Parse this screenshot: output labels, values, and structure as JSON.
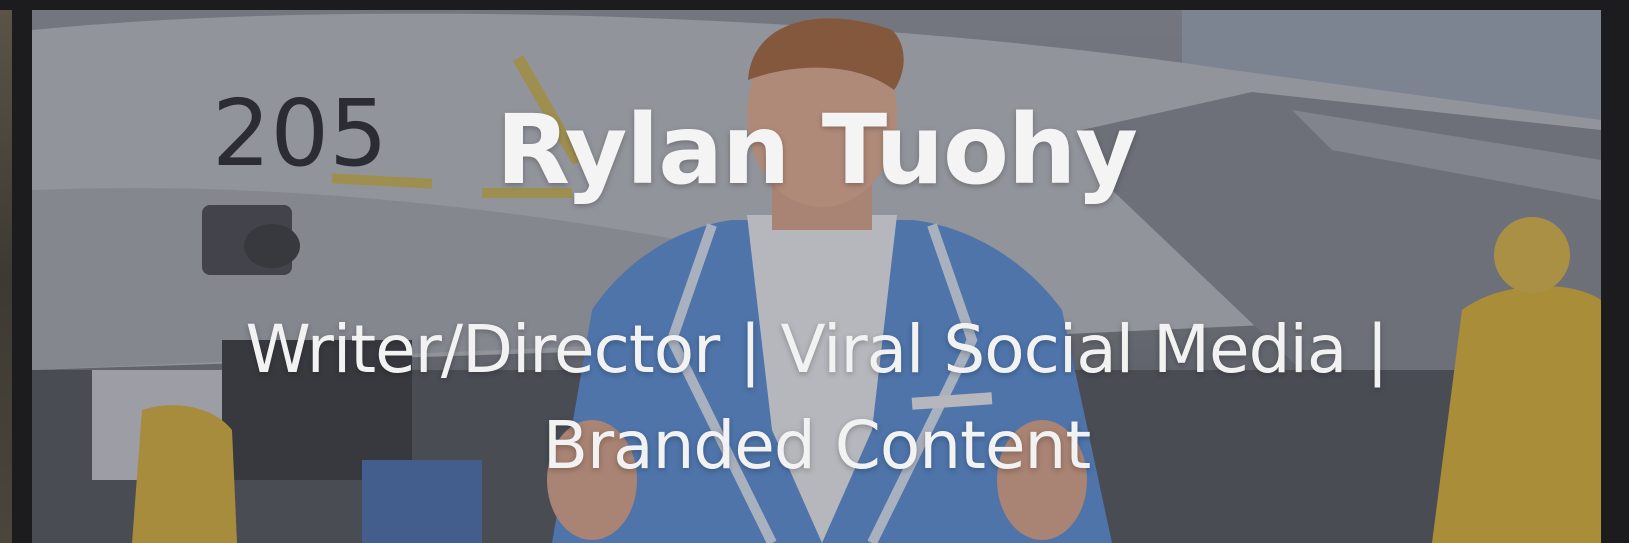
{
  "hero": {
    "title": "Rylan Tuohy",
    "subtitle": "Writer/Director | Viral Social Media | Branded Content",
    "jet_number": "205"
  },
  "colors": {
    "page_background": "#1c1c1e",
    "text": "#f4f4f4",
    "jacket": "#5b8fd6",
    "sky": "#9aa6b4",
    "crew_vest": "#d9b23a"
  }
}
